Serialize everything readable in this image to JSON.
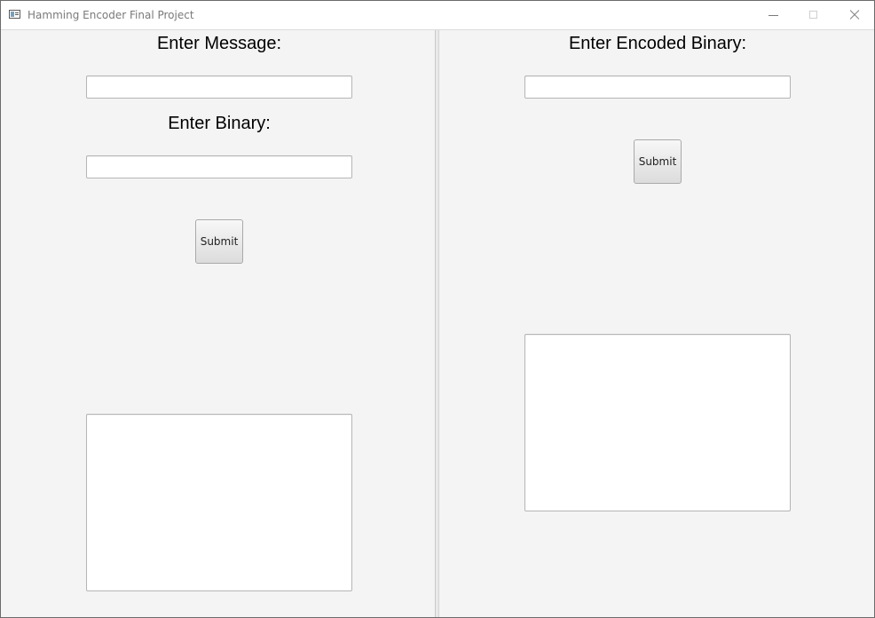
{
  "window": {
    "title": "Hamming Encoder Final Project"
  },
  "left_pane": {
    "message_label": "Enter Message:",
    "message_value": "",
    "binary_label": "Enter Binary:",
    "binary_value": "",
    "submit_label": "Submit",
    "output_value": ""
  },
  "right_pane": {
    "encoded_label": "Enter Encoded Binary:",
    "encoded_value": "",
    "submit_label": "Submit",
    "output_value": ""
  },
  "icons": {
    "app": "app-window-icon",
    "minimize": "minimize-icon",
    "maximize": "maximize-icon",
    "close": "close-icon"
  }
}
